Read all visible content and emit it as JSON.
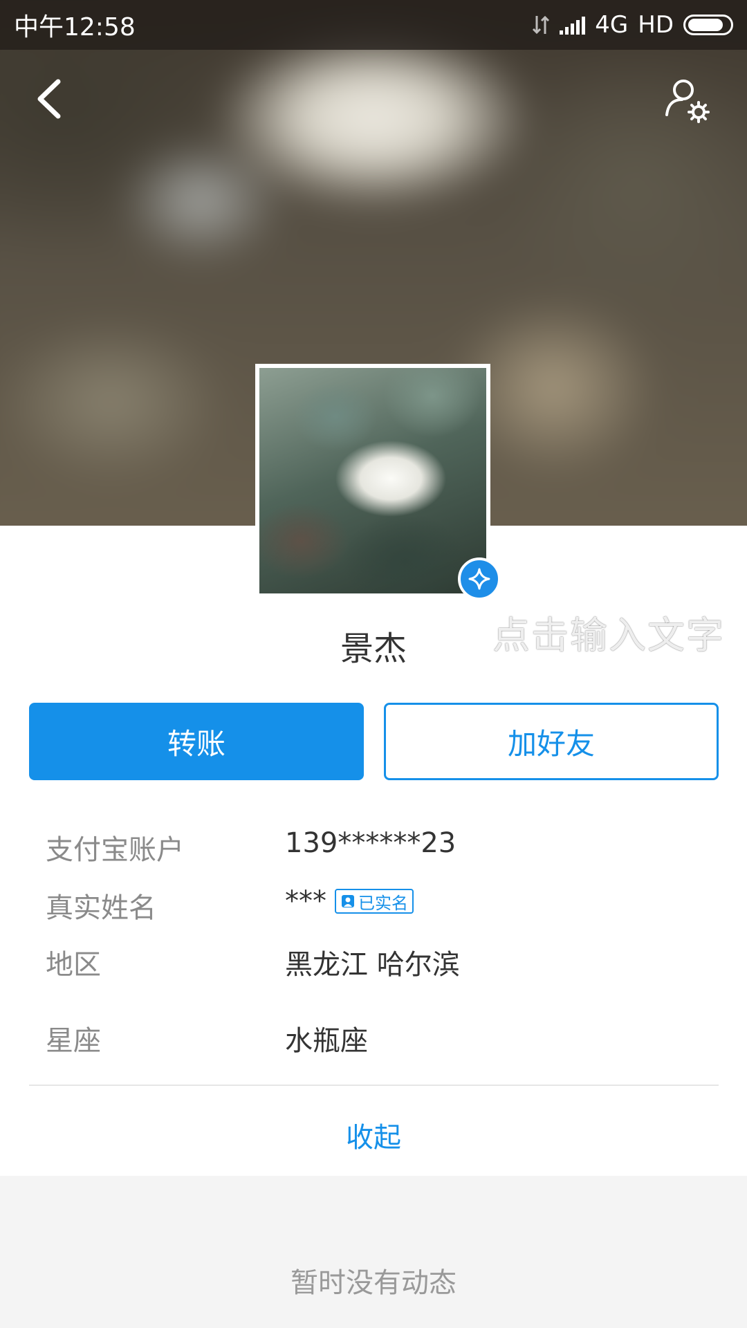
{
  "status_bar": {
    "time": "中午12:58",
    "network": "4G",
    "hd": "HD"
  },
  "header": {
    "back_icon": "chevron-left-icon",
    "settings_icon": "user-settings-icon"
  },
  "profile": {
    "nickname": "景杰",
    "watermark": "点击输入文字",
    "verified_icon": "verified-star-icon"
  },
  "actions": {
    "transfer_label": "转账",
    "add_friend_label": "加好友"
  },
  "info": {
    "rows": [
      {
        "label": "支付宝账户",
        "value": "139******23"
      },
      {
        "label": "真实姓名",
        "value": "***",
        "tag": "已实名"
      },
      {
        "label": "地区",
        "value": "黑龙江 哈尔滨"
      },
      {
        "label": "星座",
        "value": "水瓶座"
      }
    ]
  },
  "collapse_label": "收起",
  "empty_state": "暂时没有动态",
  "colors": {
    "accent": "#1590e9",
    "label_gray": "#8a8a8a",
    "background": "#f4f4f4"
  }
}
